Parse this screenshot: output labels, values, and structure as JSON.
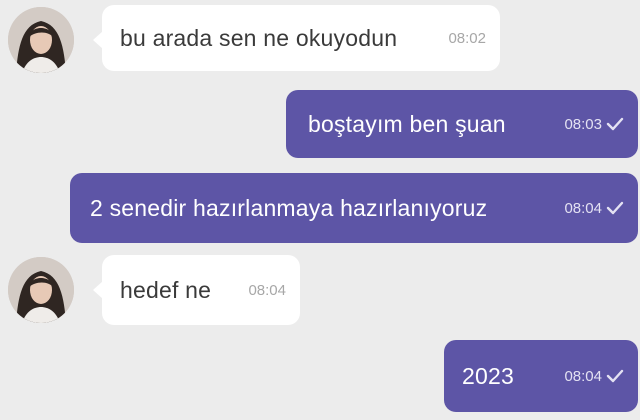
{
  "messages": [
    {
      "direction": "incoming",
      "text": "bu arada sen ne okuyodun",
      "time": "08:02"
    },
    {
      "direction": "outgoing",
      "text": "boştayım ben şuan",
      "time": "08:03",
      "status_icon": "check-icon"
    },
    {
      "direction": "outgoing",
      "text": "2 senedir hazırlanmaya hazırlanıyoruz",
      "time": "08:04",
      "status_icon": "check-icon"
    },
    {
      "direction": "incoming",
      "text": "hedef ne",
      "time": "08:04"
    },
    {
      "direction": "outgoing",
      "text": "2023",
      "time": "08:04",
      "status_icon": "check-icon"
    }
  ],
  "colors": {
    "background": "#ececec",
    "incoming_bubble": "#ffffff",
    "outgoing_bubble": "#5d55a6",
    "incoming_time": "#a7a7a7",
    "outgoing_time": "#e4e2f3"
  }
}
